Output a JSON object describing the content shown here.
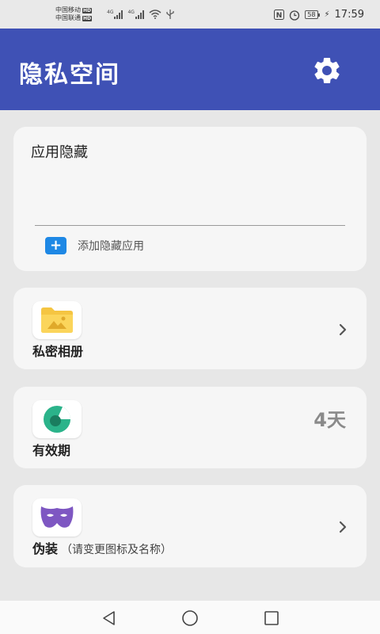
{
  "status_bar": {
    "carrier_1": "中国移动",
    "carrier_2": "中国联通",
    "hd": "HD",
    "net_1": "4G",
    "net_2": "4G",
    "battery": "58",
    "time": "17:59"
  },
  "header": {
    "title": "隐私空间",
    "settings_icon": "gear-icon",
    "background": "#3f51b5"
  },
  "app_hide": {
    "title": "应用隐藏",
    "add_label": "添加隐藏应用",
    "add_symbol": "+"
  },
  "album": {
    "label": "私密相册",
    "icon": "folder-image-icon"
  },
  "validity": {
    "label": "有效期",
    "days": "4天",
    "icon": "timer-icon"
  },
  "disguise": {
    "label": "伪装",
    "sublabel": "（请变更图标及名称）",
    "icon": "mask-icon"
  },
  "nav": {
    "back_icon": "back-triangle-icon",
    "home_icon": "home-circle-icon",
    "recents_icon": "recents-square-icon"
  }
}
